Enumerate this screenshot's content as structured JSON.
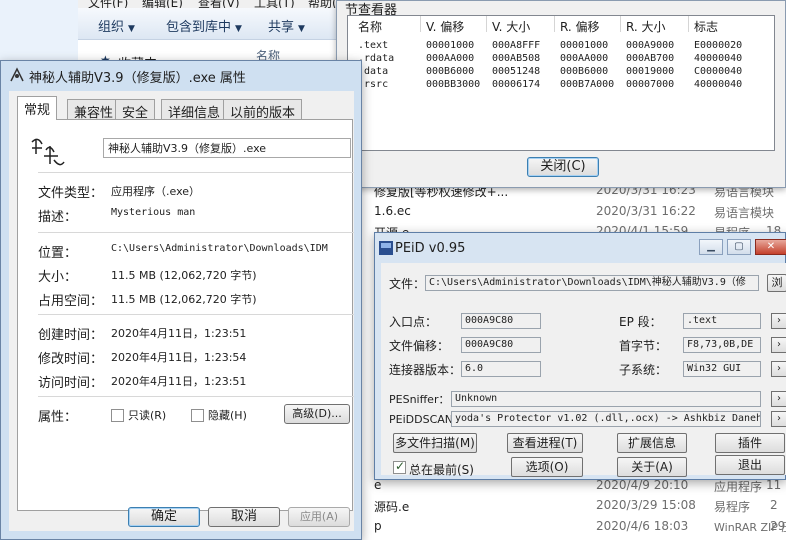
{
  "explorer": {
    "menu": [
      "文件(F)",
      "编辑(E)",
      "查看(V)",
      "工具(T)",
      "帮助(H)"
    ],
    "toolbar": {
      "organize": "组织",
      "include_library": "包含到库中",
      "share": "共享"
    },
    "favorites_label": "收藏夹",
    "column_name": "名称",
    "rows": [
      {
        "name": "修复版[等秒权速修改+...",
        "date": "2020/3/31 16:23",
        "type": "易语言模块",
        "size": ""
      },
      {
        "name": "1.6.ec",
        "date": "2020/3/31 16:22",
        "type": "易语言模块",
        "size": ""
      },
      {
        "name": "开源.e",
        "date": "2020/4/1 15:59",
        "type": "易程序",
        "size": "18"
      },
      {
        "name": "e",
        "date": "2020/4/9 20:10",
        "type": "应用程序",
        "size": "11"
      },
      {
        "name": "源码.e",
        "date": "2020/3/29 15:08",
        "type": "易程序",
        "size": "2"
      },
      {
        "name": "p",
        "date": "2020/4/6 18:03",
        "type": "WinRAR ZIP 压缩...",
        "size": "29"
      }
    ]
  },
  "section_viewer": {
    "title": "节查看器",
    "columns": [
      "名称",
      "V. 偏移",
      "V. 大小",
      "R. 偏移",
      "R. 大小",
      "标志"
    ],
    "rows": [
      [
        ".text",
        "00001000",
        "000A8FFF",
        "00001000",
        "000A9000",
        "E0000020"
      ],
      [
        ".rdata",
        "000AA000",
        "000AB508",
        "000AA000",
        "000AB700",
        "40000040"
      ],
      [
        ".data",
        "000B6000",
        "00051248",
        "000B6000",
        "00019000",
        "C0000040"
      ],
      [
        ".rsrc",
        "000BB3000",
        "00006174",
        "000B7A000",
        "00007000",
        "40000040"
      ]
    ],
    "close_button": "关闭(C)"
  },
  "properties": {
    "title": "神秘人辅助V3.9（修复版）.exe 属性",
    "tabs": [
      "常规",
      "兼容性",
      "安全",
      "详细信息",
      "以前的版本"
    ],
    "active_tab": 0,
    "filename": "神秘人辅助V3.9（修复版）.exe",
    "fields": {
      "file_type_label": "文件类型：",
      "file_type": "应用程序（.exe）",
      "description_label": "描述：",
      "description": "Mysterious man",
      "location_label": "位置：",
      "location": "C:\\Users\\Administrator\\Downloads\\IDM",
      "size_label": "大小：",
      "size": "11.5 MB (12,062,720 字节)",
      "size_on_disk_label": "占用空间：",
      "size_on_disk": "11.5 MB (12,062,720 字节)",
      "created_label": "创建时间：",
      "created": "2020年4月11日，1:23:51",
      "modified_label": "修改时间：",
      "modified": "2020年4月11日，1:23:54",
      "accessed_label": "访问时间：",
      "accessed": "2020年4月11日，1:23:51",
      "attributes_label": "属性：",
      "readonly_label": "只读(R)",
      "hidden_label": "隐藏(H)",
      "advanced_button": "高级(D)..."
    },
    "buttons": {
      "ok": "确定",
      "cancel": "取消",
      "apply": "应用(A)"
    }
  },
  "peid": {
    "title": "PEiD v0.95",
    "file_label": "文件：",
    "file_path": "C:\\Users\\Administrator\\Downloads\\IDM\\神秘人辅助V3.9（修",
    "browse_button": "浏",
    "entry_point_label": "入口点：",
    "entry_point": "000A9C80",
    "ep_section_label": "EP 段：",
    "ep_section": ".text",
    "file_offset_label": "文件偏移：",
    "file_offset": "000A9C80",
    "first_bytes_label": "首字节：",
    "first_bytes": "F8,73,0B,DE",
    "linker_label": "连接器版本：",
    "linker": "6.0",
    "subsystem_label": "子系统：",
    "subsystem": "Win32 GUI",
    "pesniffer_label": "PESniffer：",
    "pesniffer": "Unknown",
    "peiddscan_label": "PEiDDSCAN：",
    "peiddscan": "yoda's Protector v1.02 (.dll,.ocx) -> Ashkbiz Danehk",
    "buttons": {
      "multi_scan": "多文件扫描(M)",
      "view_process": "查看进程(T)",
      "extended": "扩展信息",
      "plugins": "插件",
      "options": "选项(O)",
      "about": "关于(A)",
      "exit": "退出"
    },
    "always_on_top_label": "总在最前(S)",
    "always_on_top": true
  }
}
